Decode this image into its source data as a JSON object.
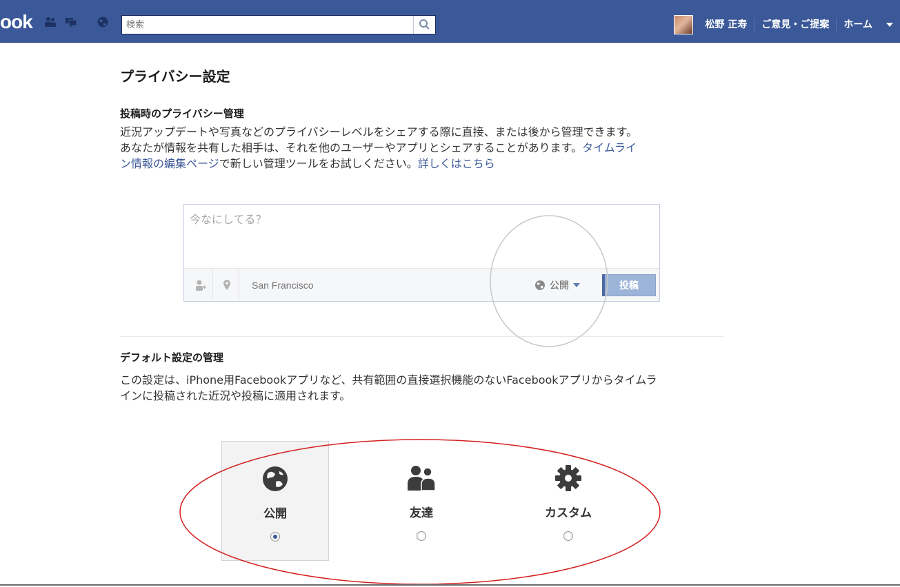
{
  "header": {
    "logo": "ook",
    "search_placeholder": "検索",
    "user_name": "松野 正寿",
    "feedback_label": "ご意見・ご提案",
    "home_label": "ホーム"
  },
  "page": {
    "title": "プライバシー設定"
  },
  "posting_privacy": {
    "title": "投稿時のプライバシー管理",
    "line1": "近況アップデートや写真などのプライバシーレベルをシェアする際に直接、または後から管理できます。",
    "line2": "あなたが情報を共有した相手は、それを他のユーザーやアプリとシェアすることがあります。",
    "link_timeline_part1": "タイムライ",
    "link_timeline_part2": "ン情報の編集ページ",
    "line3_rest": "で新しい管理ツールをお試しください。",
    "link_more": "詳しくはこちら"
  },
  "composer": {
    "placeholder": "今なにしてる？",
    "location_placeholder": "San Francisco",
    "audience_label": "公開",
    "post_button": "投稿"
  },
  "default_settings": {
    "title": "デフォルト設定の管理",
    "line1": "この設定は、iPhone用Facebookアプリなど、共有範囲の直接選択機能のないFacebookアプリからタイムラ",
    "line2": "インに投稿された近況や投稿に適用されます。"
  },
  "audience_options": [
    {
      "label": "公開",
      "icon": "globe-icon",
      "selected": true
    },
    {
      "label": "友達",
      "icon": "friends-icon",
      "selected": false
    },
    {
      "label": "カスタム",
      "icon": "gear-icon",
      "selected": false
    }
  ],
  "colors": {
    "brand": "#3b5998",
    "annotation_circle": "#c8c8c8",
    "annotation_ellipse": "#d42020"
  }
}
